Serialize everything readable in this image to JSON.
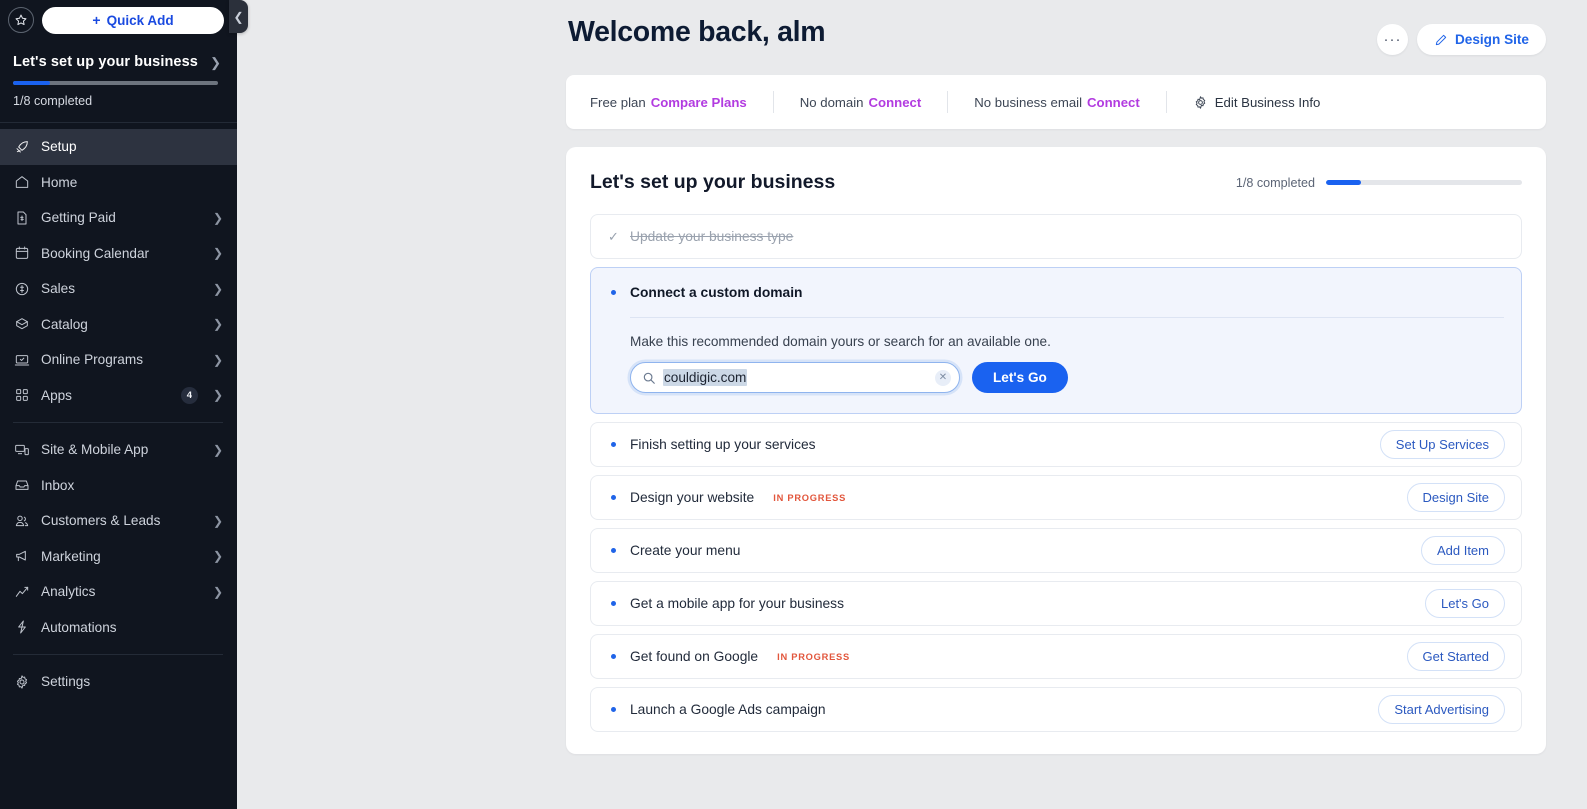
{
  "sidebar": {
    "star_icon": "star-icon",
    "quick_add_label": "Quick Add",
    "setup_panel": {
      "title": "Let's set up your business",
      "progress_label": "1/8 completed",
      "progress_percent": 12.5
    },
    "items": [
      {
        "label": "Setup",
        "icon": "rocket-icon",
        "active": true,
        "chevron": false,
        "badge": null
      },
      {
        "label": "Home",
        "icon": "home-icon",
        "active": false,
        "chevron": false,
        "badge": null
      },
      {
        "label": "Getting Paid",
        "icon": "invoice-icon",
        "active": false,
        "chevron": true,
        "badge": null
      },
      {
        "label": "Booking Calendar",
        "icon": "calendar-icon",
        "active": false,
        "chevron": true,
        "badge": null
      },
      {
        "label": "Sales",
        "icon": "dollar-icon",
        "active": false,
        "chevron": true,
        "badge": null
      },
      {
        "label": "Catalog",
        "icon": "catalog-icon",
        "active": false,
        "chevron": true,
        "badge": null
      },
      {
        "label": "Online Programs",
        "icon": "laptop-icon",
        "active": false,
        "chevron": true,
        "badge": null
      },
      {
        "label": "Apps",
        "icon": "apps-grid-icon",
        "active": false,
        "chevron": true,
        "badge": "4"
      }
    ],
    "items2": [
      {
        "label": "Site & Mobile App",
        "icon": "devices-icon",
        "active": false,
        "chevron": true
      },
      {
        "label": "Inbox",
        "icon": "inbox-icon",
        "active": false,
        "chevron": false
      },
      {
        "label": "Customers & Leads",
        "icon": "people-icon",
        "active": false,
        "chevron": true
      },
      {
        "label": "Marketing",
        "icon": "megaphone-icon",
        "active": false,
        "chevron": true
      },
      {
        "label": "Analytics",
        "icon": "chart-icon",
        "active": false,
        "chevron": true
      },
      {
        "label": "Automations",
        "icon": "bolt-icon",
        "active": false,
        "chevron": false
      }
    ],
    "items3": [
      {
        "label": "Settings",
        "icon": "gear-icon",
        "active": false,
        "chevron": false
      }
    ],
    "collapse_icon": "chevron-left-icon"
  },
  "header": {
    "title": "Welcome back, alm",
    "more_button": "···",
    "design_site_label": "Design Site",
    "design_site_icon": "pencil-icon"
  },
  "status_bar": {
    "segments": [
      {
        "text": "Free plan",
        "link": "Compare Plans"
      },
      {
        "text": "No domain",
        "link": "Connect"
      },
      {
        "text": "No business email",
        "link": "Connect"
      }
    ],
    "edit_label": "Edit Business Info",
    "edit_icon": "gear-icon",
    "link_color": "#b23be0"
  },
  "setup": {
    "title": "Let's set up your business",
    "progress_label": "1/8 completed",
    "progress_percent": 18,
    "tasks": [
      {
        "label": "Update your business type",
        "state": "done",
        "marker": "check",
        "tag": null,
        "button": null
      },
      {
        "label": "Connect a custom domain",
        "state": "active",
        "marker": "dot",
        "tag": null,
        "button": null,
        "description": "Make this recommended domain yours or search for an available one.",
        "input_value": "couldigic.com",
        "input_icon": "search-icon",
        "clear_icon": "close-x-icon",
        "cta_label": "Let's Go"
      },
      {
        "label": "Finish setting up your services",
        "state": "todo",
        "marker": "dot",
        "tag": null,
        "button": "Set Up Services"
      },
      {
        "label": "Design your website",
        "state": "todo",
        "marker": "dot",
        "tag": "IN PROGRESS",
        "button": "Design Site"
      },
      {
        "label": "Create your menu",
        "state": "todo",
        "marker": "dot",
        "tag": null,
        "button": "Add Item"
      },
      {
        "label": "Get a mobile app for your business",
        "state": "todo",
        "marker": "dot",
        "tag": null,
        "button": "Let's Go"
      },
      {
        "label": "Get found on Google",
        "state": "todo",
        "marker": "dot",
        "tag": "IN PROGRESS",
        "button": "Get Started"
      },
      {
        "label": "Launch a Google Ads campaign",
        "state": "todo",
        "marker": "dot",
        "tag": null,
        "button": "Start Advertising"
      }
    ]
  },
  "colors": {
    "sidebar_bg": "#10151f",
    "accent_blue": "#1a62f0",
    "link_purple": "#b23be0",
    "in_progress": "#e2563c",
    "page_bg": "#e9eaec"
  }
}
